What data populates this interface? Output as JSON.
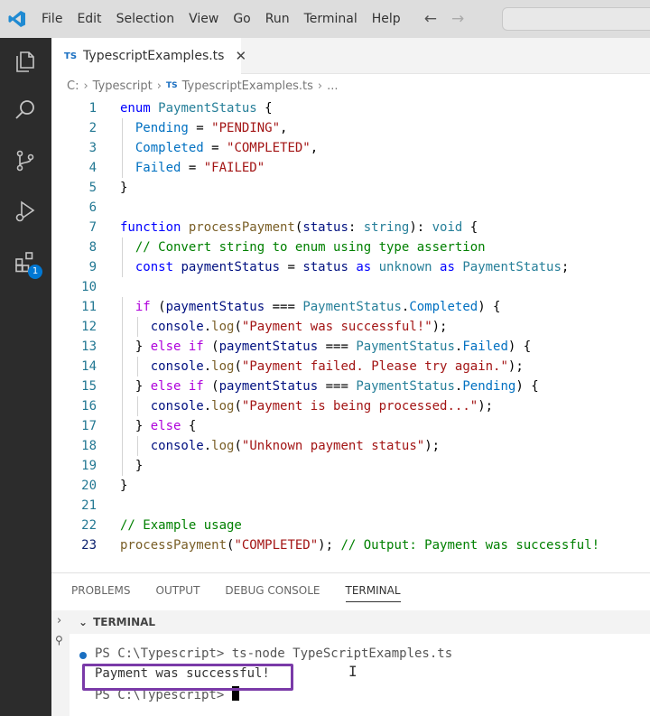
{
  "menu": [
    "File",
    "Edit",
    "Selection",
    "View",
    "Go",
    "Run",
    "Terminal",
    "Help"
  ],
  "tab": {
    "badge": "TS",
    "title": "TypescriptExamples.ts",
    "close": "✕"
  },
  "breadcrumb": {
    "drive": "C:",
    "folder": "Typescript",
    "badge": "TS",
    "file": "TypescriptExamples.ts",
    "more": "..."
  },
  "activity_badge": "1",
  "code_lines": [
    {
      "n": "1",
      "indent": 0,
      "tokens": [
        [
          "kw",
          "enum "
        ],
        [
          "en",
          "PaymentStatus"
        ],
        [
          "pl",
          " {"
        ]
      ]
    },
    {
      "n": "2",
      "indent": 1,
      "tokens": [
        [
          "mem",
          "Pending"
        ],
        [
          "pl",
          " = "
        ],
        [
          "str",
          "\"PENDING\""
        ],
        [
          "pl",
          ","
        ]
      ]
    },
    {
      "n": "3",
      "indent": 1,
      "tokens": [
        [
          "mem",
          "Completed"
        ],
        [
          "pl",
          " = "
        ],
        [
          "str",
          "\"COMPLETED\""
        ],
        [
          "pl",
          ","
        ]
      ]
    },
    {
      "n": "4",
      "indent": 1,
      "tokens": [
        [
          "mem",
          "Failed"
        ],
        [
          "pl",
          " = "
        ],
        [
          "str",
          "\"FAILED\""
        ]
      ]
    },
    {
      "n": "5",
      "indent": 0,
      "tokens": [
        [
          "pl",
          "}"
        ]
      ]
    },
    {
      "n": "6",
      "indent": 0,
      "tokens": []
    },
    {
      "n": "7",
      "indent": 0,
      "tokens": [
        [
          "kw",
          "function "
        ],
        [
          "fn",
          "processPayment"
        ],
        [
          "pl",
          "("
        ],
        [
          "var",
          "status"
        ],
        [
          "pl",
          ": "
        ],
        [
          "ty",
          "string"
        ],
        [
          "pl",
          "): "
        ],
        [
          "ty",
          "void"
        ],
        [
          "pl",
          " {"
        ]
      ]
    },
    {
      "n": "8",
      "indent": 1,
      "tokens": [
        [
          "cm",
          "// Convert string to enum using type assertion"
        ]
      ]
    },
    {
      "n": "9",
      "indent": 1,
      "tokens": [
        [
          "kw",
          "const "
        ],
        [
          "var",
          "paymentStatus"
        ],
        [
          "pl",
          " = "
        ],
        [
          "var",
          "status"
        ],
        [
          "kw",
          " as "
        ],
        [
          "ty",
          "unknown"
        ],
        [
          "kw",
          " as "
        ],
        [
          "en",
          "PaymentStatus"
        ],
        [
          "pl",
          ";"
        ]
      ]
    },
    {
      "n": "10",
      "indent": 0,
      "tokens": []
    },
    {
      "n": "11",
      "indent": 1,
      "tokens": [
        [
          "ctl",
          "if"
        ],
        [
          "pl",
          " ("
        ],
        [
          "var",
          "paymentStatus"
        ],
        [
          "pl",
          " === "
        ],
        [
          "en",
          "PaymentStatus"
        ],
        [
          "pl",
          "."
        ],
        [
          "mem",
          "Completed"
        ],
        [
          "pl",
          ") {"
        ]
      ]
    },
    {
      "n": "12",
      "indent": 2,
      "tokens": [
        [
          "var",
          "console"
        ],
        [
          "pl",
          "."
        ],
        [
          "fn",
          "log"
        ],
        [
          "pl",
          "("
        ],
        [
          "str",
          "\"Payment was successful!\""
        ],
        [
          "pl",
          ");"
        ]
      ]
    },
    {
      "n": "13",
      "indent": 1,
      "tokens": [
        [
          "pl",
          "} "
        ],
        [
          "ctl",
          "else if"
        ],
        [
          "pl",
          " ("
        ],
        [
          "var",
          "paymentStatus"
        ],
        [
          "pl",
          " === "
        ],
        [
          "en",
          "PaymentStatus"
        ],
        [
          "pl",
          "."
        ],
        [
          "mem",
          "Failed"
        ],
        [
          "pl",
          ") {"
        ]
      ]
    },
    {
      "n": "14",
      "indent": 2,
      "tokens": [
        [
          "var",
          "console"
        ],
        [
          "pl",
          "."
        ],
        [
          "fn",
          "log"
        ],
        [
          "pl",
          "("
        ],
        [
          "str",
          "\"Payment failed. Please try again.\""
        ],
        [
          "pl",
          ");"
        ]
      ]
    },
    {
      "n": "15",
      "indent": 1,
      "tokens": [
        [
          "pl",
          "} "
        ],
        [
          "ctl",
          "else if"
        ],
        [
          "pl",
          " ("
        ],
        [
          "var",
          "paymentStatus"
        ],
        [
          "pl",
          " === "
        ],
        [
          "en",
          "PaymentStatus"
        ],
        [
          "pl",
          "."
        ],
        [
          "mem",
          "Pending"
        ],
        [
          "pl",
          ") {"
        ]
      ]
    },
    {
      "n": "16",
      "indent": 2,
      "tokens": [
        [
          "var",
          "console"
        ],
        [
          "pl",
          "."
        ],
        [
          "fn",
          "log"
        ],
        [
          "pl",
          "("
        ],
        [
          "str",
          "\"Payment is being processed...\""
        ],
        [
          "pl",
          ");"
        ]
      ]
    },
    {
      "n": "17",
      "indent": 1,
      "tokens": [
        [
          "pl",
          "} "
        ],
        [
          "ctl",
          "else"
        ],
        [
          "pl",
          " {"
        ]
      ]
    },
    {
      "n": "18",
      "indent": 2,
      "tokens": [
        [
          "var",
          "console"
        ],
        [
          "pl",
          "."
        ],
        [
          "fn",
          "log"
        ],
        [
          "pl",
          "("
        ],
        [
          "str",
          "\"Unknown payment status\""
        ],
        [
          "pl",
          ");"
        ]
      ]
    },
    {
      "n": "19",
      "indent": 1,
      "tokens": [
        [
          "pl",
          "}"
        ]
      ]
    },
    {
      "n": "20",
      "indent": 0,
      "tokens": [
        [
          "pl",
          "}"
        ]
      ]
    },
    {
      "n": "21",
      "indent": 0,
      "tokens": []
    },
    {
      "n": "22",
      "indent": 0,
      "tokens": [
        [
          "cm",
          "// Example usage"
        ]
      ]
    },
    {
      "n": "23",
      "indent": 0,
      "tokens": [
        [
          "fn",
          "processPayment"
        ],
        [
          "pl",
          "("
        ],
        [
          "str",
          "\"COMPLETED\""
        ],
        [
          "pl",
          "); "
        ],
        [
          "cm",
          "// Output: Payment was successful!"
        ]
      ]
    }
  ],
  "panel": {
    "tabs": [
      "PROBLEMS",
      "OUTPUT",
      "DEBUG CONSOLE",
      "TERMINAL"
    ],
    "active_tab": "TERMINAL",
    "section_label": "TERMINAL"
  },
  "terminal": {
    "line1": "PS C:\\Typescript> ts-node TypeScriptExamples.ts",
    "line2": "Payment was successful!",
    "line3": "PS C:\\Typescript> "
  },
  "colors": {
    "activity_bg": "#2c2c2c",
    "titlebar_bg": "#dddddd",
    "accent": "#0078d4",
    "highlight_box": "#7a3aa8"
  }
}
